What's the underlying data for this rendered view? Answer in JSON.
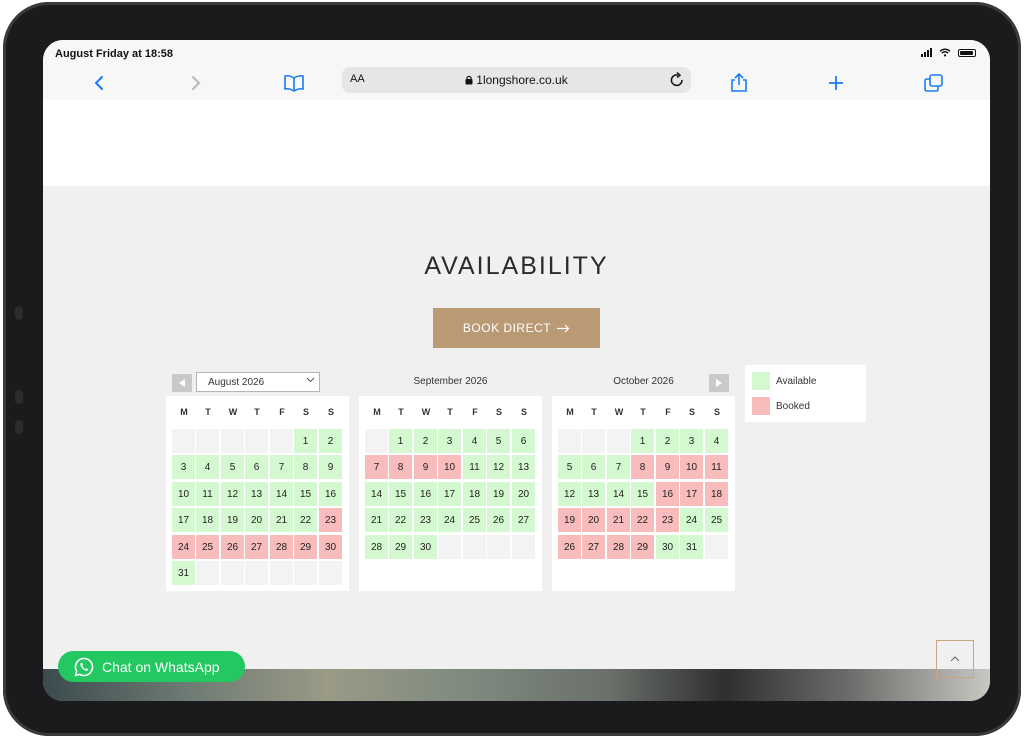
{
  "status_bar": {
    "time": "August Friday at 18:58"
  },
  "browser": {
    "text_size": "AA",
    "url": "1longshore.co.uk",
    "icons": [
      "back-icon",
      "forward-icon",
      "bookmarks-icon",
      "lock-icon",
      "reload-icon",
      "share-icon",
      "new-tab-icon",
      "tabs-icon"
    ],
    "accent_color": "#1a7cf5"
  },
  "availability": {
    "title": "AVAILABILITY",
    "book_button": "BOOK DIRECT"
  },
  "colors": {
    "available": "#d4f8cf",
    "booked": "#f7bcbb",
    "empty": "#f3f3f3",
    "button": "#b99a74",
    "whatsapp": "#23c861"
  },
  "calendars": [
    {
      "title": "August 2026",
      "weekdays": [
        "M",
        "T",
        "W",
        "T",
        "F",
        "S",
        "S"
      ],
      "cells": [
        {
          "d": "",
          "s": "empty"
        },
        {
          "d": "",
          "s": "empty"
        },
        {
          "d": "",
          "s": "empty"
        },
        {
          "d": "",
          "s": "empty"
        },
        {
          "d": "",
          "s": "empty"
        },
        {
          "d": "1",
          "s": "available"
        },
        {
          "d": "2",
          "s": "available"
        },
        {
          "d": "3",
          "s": "available"
        },
        {
          "d": "4",
          "s": "available"
        },
        {
          "d": "5",
          "s": "available"
        },
        {
          "d": "6",
          "s": "available"
        },
        {
          "d": "7",
          "s": "available"
        },
        {
          "d": "8",
          "s": "available"
        },
        {
          "d": "9",
          "s": "available"
        },
        {
          "d": "10",
          "s": "available"
        },
        {
          "d": "11",
          "s": "available"
        },
        {
          "d": "12",
          "s": "available"
        },
        {
          "d": "13",
          "s": "available"
        },
        {
          "d": "14",
          "s": "available"
        },
        {
          "d": "15",
          "s": "available"
        },
        {
          "d": "16",
          "s": "available"
        },
        {
          "d": "17",
          "s": "available"
        },
        {
          "d": "18",
          "s": "available"
        },
        {
          "d": "19",
          "s": "available"
        },
        {
          "d": "20",
          "s": "available"
        },
        {
          "d": "21",
          "s": "available"
        },
        {
          "d": "22",
          "s": "available"
        },
        {
          "d": "23",
          "s": "booked"
        },
        {
          "d": "24",
          "s": "booked"
        },
        {
          "d": "25",
          "s": "booked"
        },
        {
          "d": "26",
          "s": "booked"
        },
        {
          "d": "27",
          "s": "booked"
        },
        {
          "d": "28",
          "s": "booked"
        },
        {
          "d": "29",
          "s": "booked"
        },
        {
          "d": "30",
          "s": "booked"
        },
        {
          "d": "31",
          "s": "available"
        },
        {
          "d": "",
          "s": "empty"
        },
        {
          "d": "",
          "s": "empty"
        },
        {
          "d": "",
          "s": "empty"
        },
        {
          "d": "",
          "s": "empty"
        },
        {
          "d": "",
          "s": "empty"
        },
        {
          "d": "",
          "s": "empty"
        }
      ]
    },
    {
      "title": "September 2026",
      "weekdays": [
        "M",
        "T",
        "W",
        "T",
        "F",
        "S",
        "S"
      ],
      "cells": [
        {
          "d": "",
          "s": "empty"
        },
        {
          "d": "1",
          "s": "available"
        },
        {
          "d": "2",
          "s": "available"
        },
        {
          "d": "3",
          "s": "available"
        },
        {
          "d": "4",
          "s": "available"
        },
        {
          "d": "5",
          "s": "available"
        },
        {
          "d": "6",
          "s": "available"
        },
        {
          "d": "7",
          "s": "booked"
        },
        {
          "d": "8",
          "s": "booked"
        },
        {
          "d": "9",
          "s": "booked"
        },
        {
          "d": "10",
          "s": "booked"
        },
        {
          "d": "11",
          "s": "available"
        },
        {
          "d": "12",
          "s": "available"
        },
        {
          "d": "13",
          "s": "available"
        },
        {
          "d": "14",
          "s": "available"
        },
        {
          "d": "15",
          "s": "available"
        },
        {
          "d": "16",
          "s": "available"
        },
        {
          "d": "17",
          "s": "available"
        },
        {
          "d": "18",
          "s": "available"
        },
        {
          "d": "19",
          "s": "available"
        },
        {
          "d": "20",
          "s": "available"
        },
        {
          "d": "21",
          "s": "available"
        },
        {
          "d": "22",
          "s": "available"
        },
        {
          "d": "23",
          "s": "available"
        },
        {
          "d": "24",
          "s": "available"
        },
        {
          "d": "25",
          "s": "available"
        },
        {
          "d": "26",
          "s": "available"
        },
        {
          "d": "27",
          "s": "available"
        },
        {
          "d": "28",
          "s": "available"
        },
        {
          "d": "29",
          "s": "available"
        },
        {
          "d": "30",
          "s": "available"
        },
        {
          "d": "",
          "s": "empty"
        },
        {
          "d": "",
          "s": "empty"
        },
        {
          "d": "",
          "s": "empty"
        },
        {
          "d": "",
          "s": "empty"
        }
      ]
    },
    {
      "title": "October 2026",
      "weekdays": [
        "M",
        "T",
        "W",
        "T",
        "F",
        "S",
        "S"
      ],
      "cells": [
        {
          "d": "",
          "s": "empty"
        },
        {
          "d": "",
          "s": "empty"
        },
        {
          "d": "",
          "s": "empty"
        },
        {
          "d": "1",
          "s": "available"
        },
        {
          "d": "2",
          "s": "available"
        },
        {
          "d": "3",
          "s": "available"
        },
        {
          "d": "4",
          "s": "available"
        },
        {
          "d": "5",
          "s": "available"
        },
        {
          "d": "6",
          "s": "available"
        },
        {
          "d": "7",
          "s": "available"
        },
        {
          "d": "8",
          "s": "booked"
        },
        {
          "d": "9",
          "s": "booked"
        },
        {
          "d": "10",
          "s": "booked"
        },
        {
          "d": "11",
          "s": "booked"
        },
        {
          "d": "12",
          "s": "available"
        },
        {
          "d": "13",
          "s": "available"
        },
        {
          "d": "14",
          "s": "available"
        },
        {
          "d": "15",
          "s": "available"
        },
        {
          "d": "16",
          "s": "booked"
        },
        {
          "d": "17",
          "s": "booked"
        },
        {
          "d": "18",
          "s": "booked"
        },
        {
          "d": "19",
          "s": "booked"
        },
        {
          "d": "20",
          "s": "booked"
        },
        {
          "d": "21",
          "s": "booked"
        },
        {
          "d": "22",
          "s": "booked"
        },
        {
          "d": "23",
          "s": "booked"
        },
        {
          "d": "24",
          "s": "available"
        },
        {
          "d": "25",
          "s": "available"
        },
        {
          "d": "26",
          "s": "booked"
        },
        {
          "d": "27",
          "s": "booked"
        },
        {
          "d": "28",
          "s": "booked"
        },
        {
          "d": "29",
          "s": "booked"
        },
        {
          "d": "30",
          "s": "available"
        },
        {
          "d": "31",
          "s": "available"
        },
        {
          "d": "",
          "s": "empty"
        }
      ]
    }
  ],
  "legend": {
    "available": "Available",
    "booked": "Booked"
  },
  "whatsapp": {
    "label": "Chat on WhatsApp"
  }
}
